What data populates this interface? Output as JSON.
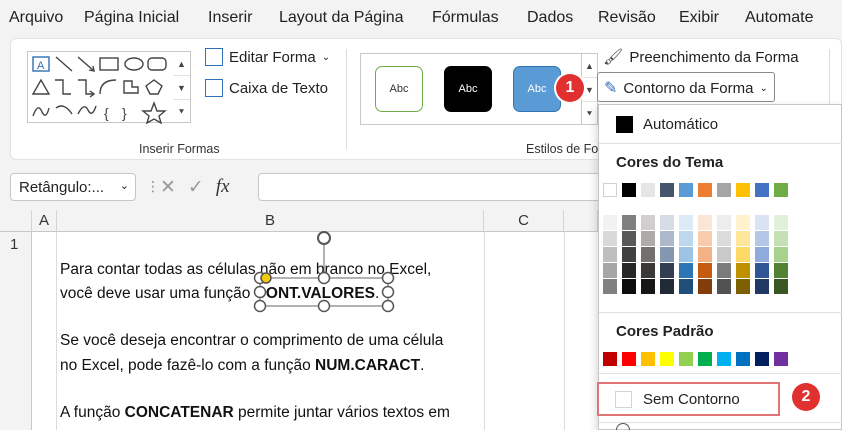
{
  "menu": [
    "Arquivo",
    "Página Inicial",
    "Inserir",
    "Layout da Página",
    "Fórmulas",
    "Dados",
    "Revisão",
    "Exibir",
    "Automate"
  ],
  "ribbon": {
    "edit_shape": "Editar Forma",
    "text_box": "Caixa de Texto",
    "insert_shapes_label": "Inserir Formas",
    "shape_styles_label": "Estilos de Fo",
    "style_tiles": [
      "Abc",
      "Abc",
      "Abc"
    ],
    "shape_fill": "Preenchimento da Forma",
    "shape_outline": "Contorno da Forma"
  },
  "formula_bar": {
    "name_box": "Retângulo:...",
    "fx": "fx",
    "value": ""
  },
  "sheet": {
    "columns": [
      "A",
      "B",
      "C"
    ],
    "row_number": "1",
    "lines": [
      {
        "pre": "Para contar todas as células não em branco no Excel,",
        "bold": "",
        "post": ""
      },
      {
        "pre": "você deve usar uma função ",
        "bold": "CONT.VALORES",
        "post": "."
      },
      {
        "pre": "Se você deseja encontrar o comprimento de uma célula",
        "bold": "",
        "post": ""
      },
      {
        "pre": "no Excel, pode fazê-lo com a função ",
        "bold": "NUM.CARACT",
        "post": "."
      },
      {
        "pre": "A função ",
        "bold": "CONCATENAR",
        "post": " permite juntar vários textos em"
      }
    ]
  },
  "dropdown": {
    "automatic": "Automático",
    "theme_colors_label": "Cores do Tema",
    "theme_colors": [
      "#ffffff",
      "#000000",
      "#e7e6e6",
      "#44546a",
      "#5b9bd5",
      "#ed7d31",
      "#a5a5a5",
      "#ffc000",
      "#4472c4",
      "#70ad47"
    ],
    "shade_columns": [
      [
        "#f2f2f2",
        "#d9d9d9",
        "#bfbfbf",
        "#a6a6a6",
        "#808080"
      ],
      [
        "#808080",
        "#595959",
        "#404040",
        "#262626",
        "#0d0d0d"
      ],
      [
        "#d0cece",
        "#aeaaaa",
        "#757070",
        "#3b3838",
        "#171616"
      ],
      [
        "#d6dce5",
        "#adb9ca",
        "#8497b0",
        "#333f50",
        "#222a35"
      ],
      [
        "#deebf7",
        "#bdd7ee",
        "#9dc3e6",
        "#2e75b6",
        "#1f4e79"
      ],
      [
        "#fbe5d6",
        "#f8cbad",
        "#f4b183",
        "#c55a11",
        "#843c0c"
      ],
      [
        "#ededed",
        "#dbdbdb",
        "#c9c9c9",
        "#7b7b7b",
        "#525252"
      ],
      [
        "#fff2cc",
        "#ffe699",
        "#ffd966",
        "#bf9000",
        "#7f6000"
      ],
      [
        "#dae3f3",
        "#b4c7e7",
        "#8faadc",
        "#2f5597",
        "#203864"
      ],
      [
        "#e2f0d9",
        "#c5e0b4",
        "#a9d18e",
        "#548235",
        "#385723"
      ]
    ],
    "standard_colors_label": "Cores Padrão",
    "standard_colors": [
      "#c00000",
      "#ff0000",
      "#ffc000",
      "#ffff00",
      "#92d050",
      "#00b050",
      "#00b0f0",
      "#0070c0",
      "#002060",
      "#7030a0"
    ],
    "no_outline": "Sem Contorno"
  },
  "badges": [
    "1",
    "2"
  ],
  "colors": {
    "accent": "#2f6fb3",
    "badge": "#e0302f"
  }
}
